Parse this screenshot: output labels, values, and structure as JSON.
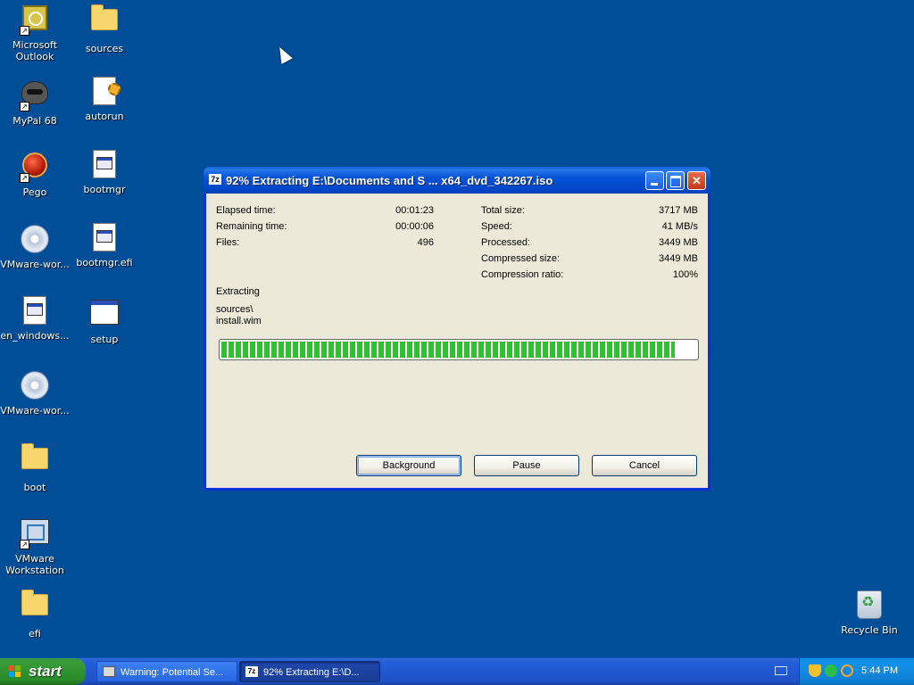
{
  "desktop": {
    "icons_col1": [
      {
        "label": "Microsoft Outlook",
        "icon": "outlook-icon"
      },
      {
        "label": "MyPal 68",
        "icon": "mypal-icon"
      },
      {
        "label": "Pego",
        "icon": "pego-icon"
      },
      {
        "label": "VMware-wor...",
        "icon": "vmware-disc-icon"
      },
      {
        "label": "en_windows...",
        "icon": "file-icon"
      },
      {
        "label": "VMware-wor...",
        "icon": "vmware-disc-icon"
      },
      {
        "label": "boot",
        "icon": "folder-icon"
      },
      {
        "label": "VMware Workstation",
        "icon": "vmware-workstation-icon"
      },
      {
        "label": "efi",
        "icon": "folder-icon"
      }
    ],
    "icons_col2": [
      {
        "label": "sources",
        "icon": "folder-icon"
      },
      {
        "label": "autorun",
        "icon": "autorun-icon"
      },
      {
        "label": "bootmgr",
        "icon": "file-icon"
      },
      {
        "label": "bootmgr.efi",
        "icon": "file-icon"
      },
      {
        "label": "setup",
        "icon": "window-icon"
      }
    ],
    "recycle_bin": "Recycle Bin"
  },
  "dialog": {
    "title": "92% Extracting E:\\Documents and S ... x64_dvd_342267.iso",
    "app_icon": "7z",
    "left_stats": [
      {
        "label": "Elapsed time:",
        "value": "00:01:23"
      },
      {
        "label": "Remaining time:",
        "value": "00:00:06"
      },
      {
        "label": "Files:",
        "value": "496"
      }
    ],
    "right_stats": [
      {
        "label": "Total size:",
        "value": "3717 MB"
      },
      {
        "label": "Speed:",
        "value": "41 MB/s"
      },
      {
        "label": "Processed:",
        "value": "3449 MB"
      },
      {
        "label": "Compressed size:",
        "value": "3449 MB"
      },
      {
        "label": "Compression ratio:",
        "value": "100%"
      }
    ],
    "status_label": "Extracting",
    "current_dir": "sources\\",
    "current_file": "install.wim",
    "progress_fraction": 0.955,
    "buttons": {
      "background": "Background",
      "pause": "Pause",
      "cancel": "Cancel"
    }
  },
  "taskbar": {
    "start_label": "start",
    "tasks": [
      {
        "label": "Warning: Potential Se...",
        "active": false
      },
      {
        "label": "92% Extracting E:\\D...",
        "active": true
      }
    ],
    "clock": "5:44 PM"
  },
  "colors": {
    "desktop": "#004e98",
    "titlebar": "#0553d6",
    "progress": "#2fc02f",
    "dialog_bg": "#ece9d8"
  }
}
